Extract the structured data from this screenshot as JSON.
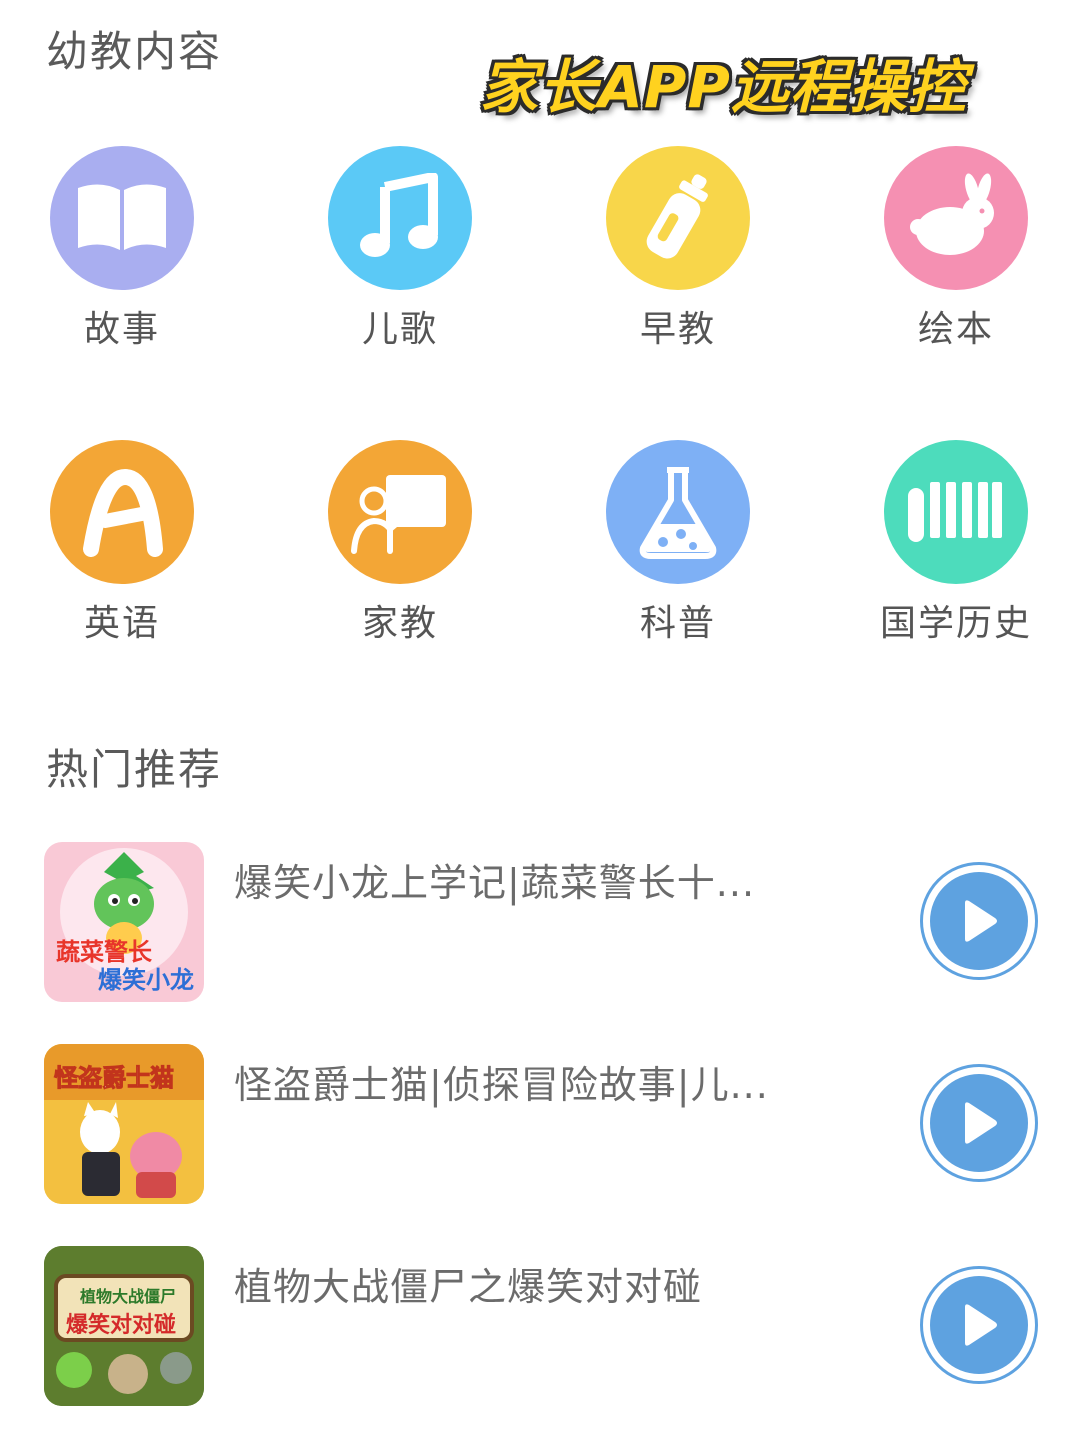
{
  "edu_section": {
    "title": "幼教内容"
  },
  "banner": {
    "text": "家长APP远程操控"
  },
  "categories": [
    {
      "label": "故事",
      "icon": "book-icon",
      "color": "#a9aef0"
    },
    {
      "label": "儿歌",
      "icon": "music-note-icon",
      "color": "#5bc9f6"
    },
    {
      "label": "早教",
      "icon": "baby-bottle-icon",
      "color": "#f8d64a"
    },
    {
      "label": "绘本",
      "icon": "rabbit-icon",
      "color": "#f590b2"
    },
    {
      "label": "英语",
      "icon": "letter-a-icon",
      "color": "#f3a636"
    },
    {
      "label": "家教",
      "icon": "teacher-board-icon",
      "color": "#f3a636"
    },
    {
      "label": "科普",
      "icon": "flask-icon",
      "color": "#7eb0f5"
    },
    {
      "label": "国学历史",
      "icon": "scroll-icon",
      "color": "#4ddcbc"
    }
  ],
  "hot_section": {
    "title": "热门推荐"
  },
  "recommendations": [
    {
      "title": "爆笑小龙上学记|蔬菜警长十...",
      "thumb_caption": [
        "蔬菜警长",
        "爆笑小龙"
      ],
      "thumb_icon": "dragon-thumbnail-icon"
    },
    {
      "title": "怪盗爵士猫|侦探冒险故事|儿...",
      "thumb_caption": [
        "怪盗爵士猫"
      ],
      "thumb_icon": "jazz-cat-thumbnail-icon"
    },
    {
      "title": "植物大战僵尸之爆笑对对碰",
      "thumb_caption": [
        "植物大战僵尸",
        "爆笑对对碰"
      ],
      "thumb_icon": "pvz-thumbnail-icon"
    }
  ],
  "colors": {
    "accent_blue": "#5ea2e0",
    "banner_yellow": "#ffd21f"
  }
}
